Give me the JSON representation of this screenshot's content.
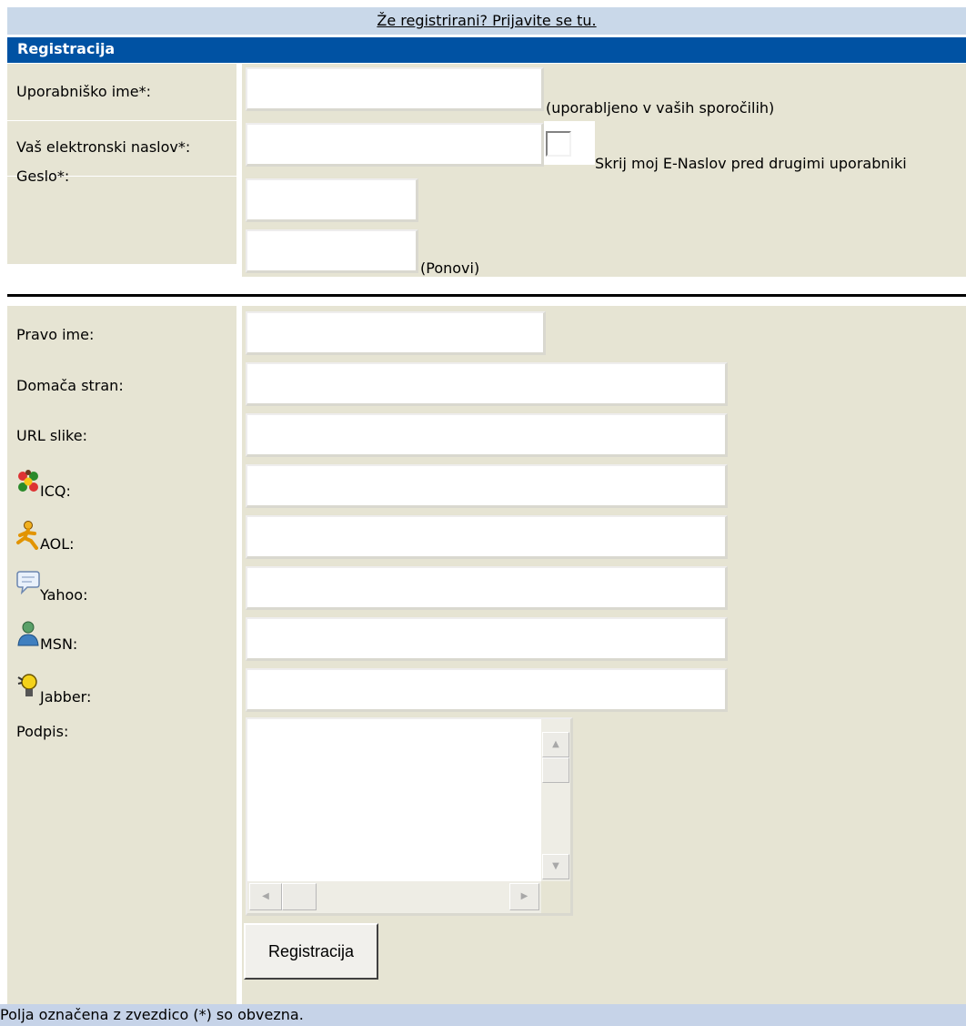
{
  "top_link": "Že registrirani? Prijavite se tu.",
  "section_title": "Registracija",
  "fields": {
    "username_label": "Uporabniško ime*:",
    "username_note": "(uporabljeno v vaših sporočilih)",
    "email_label": "Vaš elektronski naslov*:",
    "hide_email_label": "Skrij moj E-Naslov pred drugimi uporabniki",
    "password_label": "Geslo*:",
    "password_repeat_note": "(Ponovi)",
    "realname_label": "Pravo ime:",
    "homepage_label": "Domača stran:",
    "avatar_url_label": "URL slike:",
    "icq_label": "ICQ:",
    "aol_label": "AOL:",
    "yahoo_label": "Yahoo:",
    "msn_label": "MSN:",
    "jabber_label": "Jabber:",
    "signature_label": "Podpis:"
  },
  "icons": {
    "icq": "icq-flower-icon",
    "aol": "aol-running-man-icon",
    "yahoo": "yahoo-speech-bubble-icon",
    "msn": "msn-buddy-icon",
    "jabber": "jabber-lightbulb-icon"
  },
  "register_button": "Registracija",
  "footer_note": "Polja označena z zvezdico (*) so obvezna.",
  "colors": {
    "header_bg": "#0052a3",
    "panel_bg": "#e6e4d3",
    "top_bar_bg": "#c9d8e9",
    "footer_bg": "#c6d3e8"
  }
}
